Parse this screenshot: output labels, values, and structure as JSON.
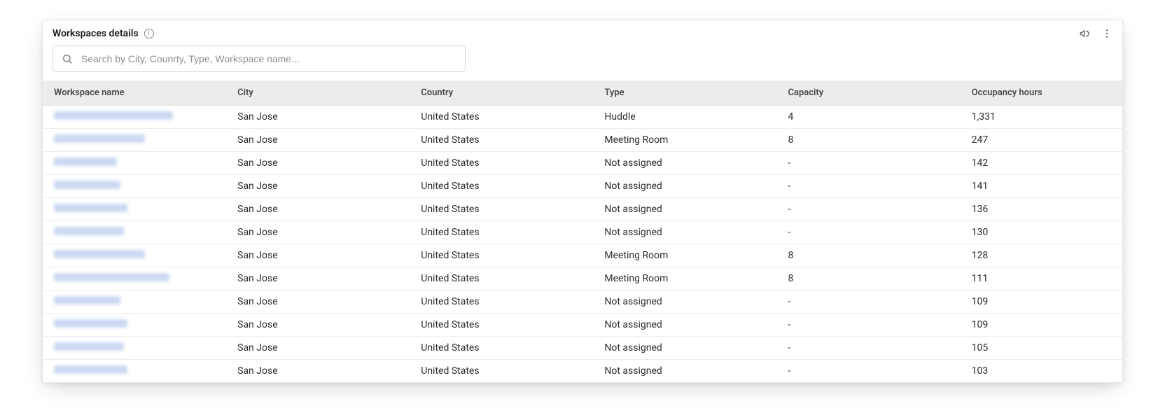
{
  "header": {
    "title": "Workspaces details"
  },
  "search": {
    "value": "",
    "placeholder": "Search by City, Counrty, Type, Workspace name..."
  },
  "table": {
    "columns": {
      "workspace_name": "Workspace name",
      "city": "City",
      "country": "Country",
      "type": "Type",
      "capacity": "Capacity",
      "occupancy_hours": "Occupancy hours"
    },
    "rows": [
      {
        "name_redacted_width": 170,
        "city": "San Jose",
        "country": "United States",
        "type": "Huddle",
        "capacity": "4",
        "hours": "1,331"
      },
      {
        "name_redacted_width": 130,
        "city": "San Jose",
        "country": "United States",
        "type": "Meeting Room",
        "capacity": "8",
        "hours": "247"
      },
      {
        "name_redacted_width": 90,
        "city": "San Jose",
        "country": "United States",
        "type": "Not assigned",
        "capacity": "-",
        "hours": "142"
      },
      {
        "name_redacted_width": 95,
        "city": "San Jose",
        "country": "United States",
        "type": "Not assigned",
        "capacity": "-",
        "hours": "141"
      },
      {
        "name_redacted_width": 105,
        "city": "San Jose",
        "country": "United States",
        "type": "Not assigned",
        "capacity": "-",
        "hours": "136"
      },
      {
        "name_redacted_width": 100,
        "city": "San Jose",
        "country": "United States",
        "type": "Not assigned",
        "capacity": "-",
        "hours": "130"
      },
      {
        "name_redacted_width": 130,
        "city": "San Jose",
        "country": "United States",
        "type": "Meeting Room",
        "capacity": "8",
        "hours": "128"
      },
      {
        "name_redacted_width": 165,
        "city": "San Jose",
        "country": "United States",
        "type": "Meeting Room",
        "capacity": "8",
        "hours": "111"
      },
      {
        "name_redacted_width": 95,
        "city": "San Jose",
        "country": "United States",
        "type": "Not assigned",
        "capacity": "-",
        "hours": "109"
      },
      {
        "name_redacted_width": 105,
        "city": "San Jose",
        "country": "United States",
        "type": "Not assigned",
        "capacity": "-",
        "hours": "109"
      },
      {
        "name_redacted_width": 100,
        "city": "San Jose",
        "country": "United States",
        "type": "Not assigned",
        "capacity": "-",
        "hours": "105"
      },
      {
        "name_redacted_width": 105,
        "city": "San Jose",
        "country": "United States",
        "type": "Not assigned",
        "capacity": "-",
        "hours": "103"
      }
    ]
  }
}
